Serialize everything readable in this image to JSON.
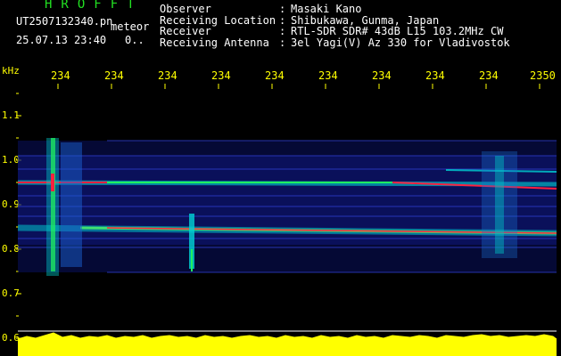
{
  "header": {
    "app_title": "HROFFT",
    "file_name": "UT2507132340.pn",
    "file_suffix": "meteor",
    "date_time": "25.07.13 23:40",
    "frame_no": "0.."
  },
  "meta": [
    {
      "key": "Observer",
      "sep": ":",
      "value": "Masaki Kano"
    },
    {
      "key": "Receiving Location",
      "sep": ":",
      "value": "Shibukawa, Gunma, Japan"
    },
    {
      "key": "Receiver",
      "sep": ":",
      "value": "RTL-SDR SDR# 43dB L15 103.2MHz CW"
    },
    {
      "key": "Receiving Antenna",
      "sep": ":",
      "value": "3el Yagi(V) Az 330 for Vladivostok"
    }
  ],
  "axis": {
    "y_unit": "kHz",
    "y_ticks": [
      "1.1",
      "1.0",
      "0.9",
      "0.8",
      "0.7",
      "0.6"
    ],
    "x_ticks": [
      "234",
      "234",
      "234",
      "234",
      "234",
      "234",
      "234",
      "234",
      "234",
      "2350"
    ]
  },
  "colors": {
    "background": "#000000",
    "label": "#ffff00",
    "title": "#22e022",
    "signal_low": "#1a2aa8",
    "signal_mid": "#00d4d4",
    "signal_high": "#ff2040",
    "amplitude": "#ffff00"
  }
}
